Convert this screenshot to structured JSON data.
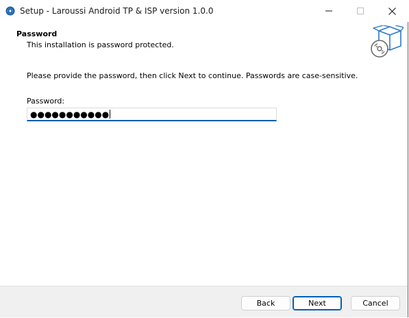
{
  "window": {
    "title": "Setup - Laroussi Android TP & ISP version 1.0.0"
  },
  "header": {
    "title": "Password",
    "subtitle": "This installation is password protected."
  },
  "body": {
    "instruction": "Please provide the password, then click Next to continue. Passwords are case-sensitive.",
    "password_label": "Password:",
    "password_value": "●●●●●●●●●●●"
  },
  "footer": {
    "back_label": "Back",
    "next_label": "Next",
    "cancel_label": "Cancel"
  },
  "icons": {
    "app": "setup-app-icon",
    "wizard": "box-with-cd-icon",
    "minimize": "minimize-icon",
    "maximize": "maximize-icon",
    "close": "close-icon"
  },
  "colors": {
    "accent": "#005fb8",
    "input_focus": "#0b5cad",
    "footer_bg": "#f0f0f0"
  }
}
